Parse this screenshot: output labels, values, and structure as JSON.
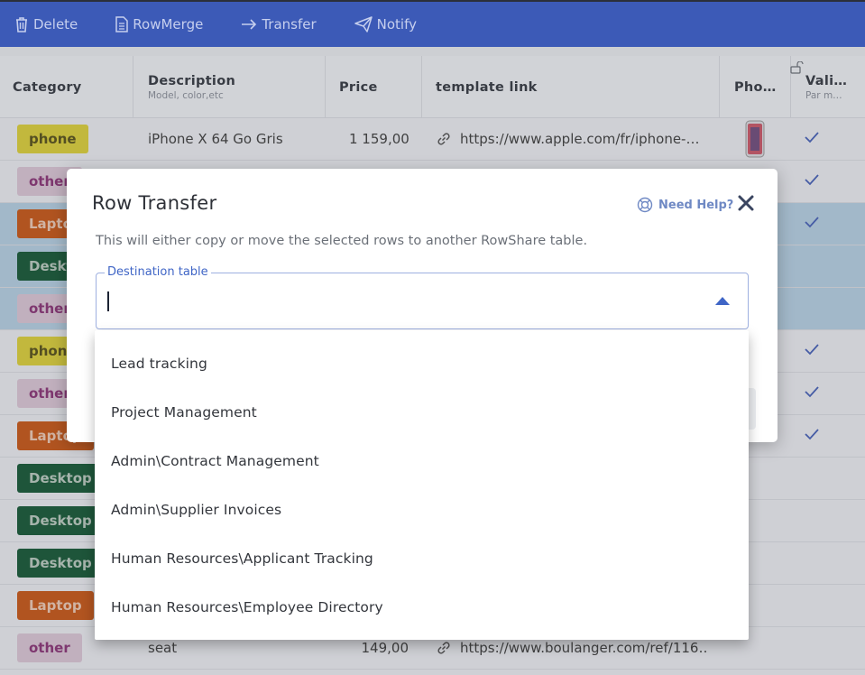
{
  "toolbar": {
    "delete_label": "Delete",
    "rowmerge_label": "RowMerge",
    "transfer_label": "Transfer",
    "notify_label": "Notify"
  },
  "grid": {
    "columns": [
      {
        "title": "Category",
        "subtitle": ""
      },
      {
        "title": "Description",
        "subtitle": "Model, color,etc"
      },
      {
        "title": "Price",
        "subtitle": ""
      },
      {
        "title": "template link",
        "subtitle": ""
      },
      {
        "title": "Pho…",
        "subtitle": ""
      },
      {
        "title": "Vali…",
        "subtitle": "Par m…"
      }
    ],
    "rows": [
      {
        "category": "phone",
        "description": "iPhone X 64 Go Gris",
        "price": "1 159,00",
        "link": "https://www.apple.com/fr/iphone-…",
        "validated": true
      },
      {
        "category": "other",
        "validated": true
      },
      {
        "category": "Laptop",
        "validated": true
      },
      {
        "category": "Desktop",
        "validated": false
      },
      {
        "category": "other",
        "validated": false
      },
      {
        "category": "phone",
        "validated": true
      },
      {
        "category": "other",
        "validated": true
      },
      {
        "category": "Laptop",
        "validated": true
      },
      {
        "category": "Desktop",
        "validated": false
      },
      {
        "category": "Desktop",
        "validated": false
      },
      {
        "category": "Desktop",
        "validated": false
      },
      {
        "category": "Laptop",
        "validated": false
      },
      {
        "category": "other",
        "description": "seat",
        "price": "149,00",
        "link": "https://www.boulanger.com/ref/116…",
        "validated": false
      }
    ]
  },
  "modal": {
    "title": "Row Transfer",
    "help_label": "Need Help?",
    "description": "This will either copy or move the selected rows to another RowShare table.",
    "field_label": "Destination table",
    "field_value": "",
    "options": [
      "Lead tracking",
      "Project Management",
      "Admin\\Contract Management",
      "Admin\\Supplier Invoices",
      "Human Resources\\Applicant Tracking",
      "Human Resources\\Employee Directory"
    ]
  },
  "colors": {
    "toolbar_bg": "#3c5ab7",
    "accent": "#3f65c6",
    "selected_row": "#b3ccde"
  }
}
